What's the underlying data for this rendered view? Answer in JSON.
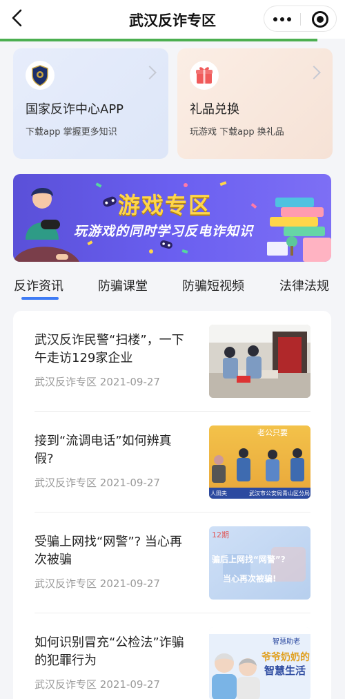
{
  "header": {
    "title": "武汉反诈专区"
  },
  "cards": [
    {
      "title": "国家反诈中心APP",
      "subtitle": "下载app 掌握更多知识",
      "icon": "police-badge-icon"
    },
    {
      "title": "礼品兑换",
      "subtitle": "玩游戏 下载app 换礼品",
      "icon": "gift-icon"
    }
  ],
  "banner": {
    "title": "游戏专区",
    "subtitle": "玩游戏的同时学习反电诈知识"
  },
  "tabs": [
    "反诈资讯",
    "防骗课堂",
    "防骗短视频",
    "法律法规"
  ],
  "articles": [
    {
      "title": "武汉反诈民警“扫楼”，一下午走访129家企业",
      "source": "武汉反诈专区",
      "date": "2021-09-27"
    },
    {
      "title": "接到“流调电话”如何辨真假?",
      "source": "武汉反诈专区",
      "date": "2021-09-27"
    },
    {
      "title": "受骗上网找“网警”? 当心再次被骗",
      "source": "武汉反诈专区",
      "date": "2021-09-27"
    },
    {
      "title": "如何识别冒充“公检法”诈骗的犯罪行为",
      "source": "武汉反诈专区",
      "date": "2021-09-27"
    }
  ],
  "thumb_text": {
    "a2_top": "老公只要",
    "a2_bottom": "武汉市公安局青山区分局",
    "a2_left": "人田夫",
    "a3_top": "12期",
    "a3_mid": "骗后上网找“网警”?",
    "a3_bot": "当心再次被骗!",
    "a4_top": "智慧助老",
    "a4_mid": "爷爷奶奶的",
    "a4_bot": "智慧生活"
  },
  "colors": {
    "accent": "#3e7bf5",
    "progress": "#4caf50",
    "banner_title": "#ffd64a"
  }
}
